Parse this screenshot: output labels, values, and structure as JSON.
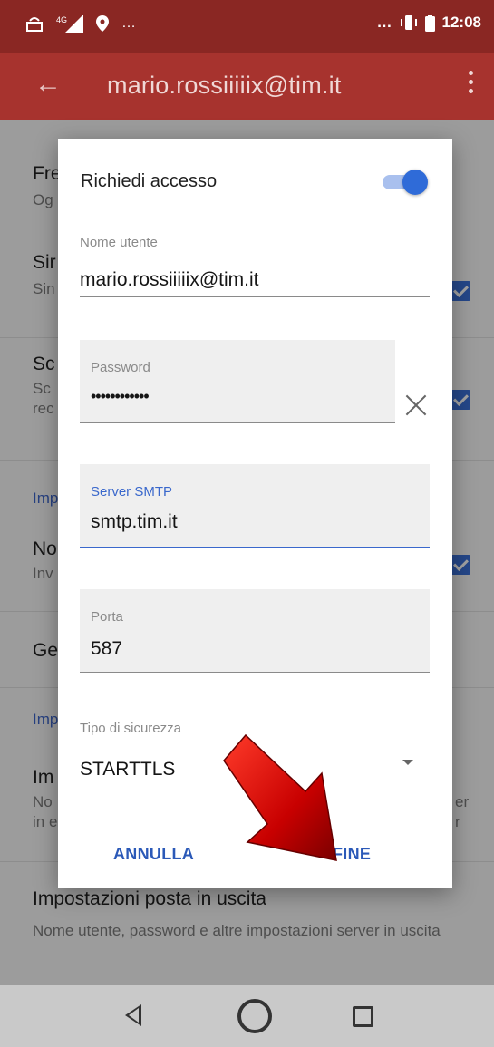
{
  "status_bar": {
    "time": "12:08",
    "signal_label": "4G",
    "more": "…"
  },
  "app_bar": {
    "title": "mario.rossiiiiix@tim.it"
  },
  "background_list": {
    "row1": {
      "title": "Fre",
      "subtitle": "Og"
    },
    "row2": {
      "title": "Sir",
      "subtitle": "Sin"
    },
    "row3": {
      "title": "Sc",
      "subtitle": "Sc",
      "subtitle2": "rec"
    },
    "section1": "Imp",
    "row4": {
      "title": "No",
      "subtitle": "Inv"
    },
    "row5": {
      "title": "Ge"
    },
    "section2": "Imp",
    "row6": {
      "title": "Im",
      "subtitle": "No",
      "subtitle_right": "er",
      "subtitle2": "in e",
      "subtitle2_right": "r"
    },
    "row7": {
      "title": "Impostazioni posta in uscita",
      "subtitle": "Nome utente, password e altre impostazioni server in uscita"
    }
  },
  "dialog": {
    "require_access_label": "Richiedi accesso",
    "require_access_on": true,
    "username": {
      "label": "Nome utente",
      "value": "mario.rossiiiiix@tim.it"
    },
    "password": {
      "label": "Password",
      "value": "••••••••••••"
    },
    "smtp_server": {
      "label": "Server SMTP",
      "value": "smtp.tim.it"
    },
    "port": {
      "label": "Porta",
      "value": "587"
    },
    "security_type": {
      "label": "Tipo di sicurezza",
      "value": "STARTTLS"
    },
    "cancel_label": "ANNULLA",
    "done_label": "FINE"
  },
  "colors": {
    "app_bar": "#a7332e",
    "status_bar": "#8a2723",
    "accent": "#2f6bd8",
    "annotation_arrow": "#d00000"
  },
  "icons": {
    "back": "arrow-left-icon",
    "overflow": "more-vert-icon",
    "clear": "close-icon",
    "dropdown": "caret-down-icon",
    "nav_back": "triangle-back-icon",
    "nav_home": "circle-home-icon",
    "nav_recent": "square-recent-icon"
  }
}
